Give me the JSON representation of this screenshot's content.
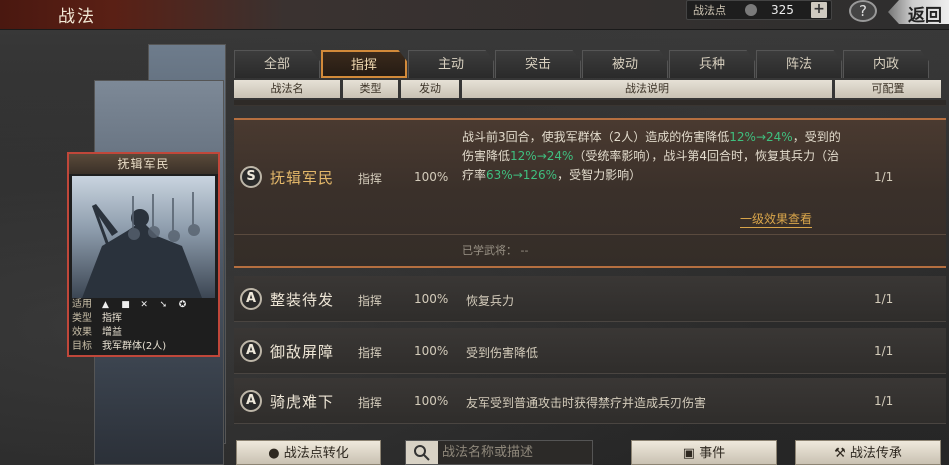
{
  "header": {
    "title": "战法",
    "points_label": "战法点",
    "points_value": "325",
    "plus_label": "+",
    "help_label": "?",
    "back_label": "返回"
  },
  "card": {
    "title": "抚辑军民",
    "info": [
      {
        "key": "适用",
        "value": ""
      },
      {
        "key": "类型",
        "value": "指挥"
      },
      {
        "key": "效果",
        "value": "增益"
      },
      {
        "key": "目标",
        "value": "我军群体(2人)"
      }
    ]
  },
  "tabs": [
    "全部",
    "指挥",
    "主动",
    "突击",
    "被动",
    "兵种",
    "阵法",
    "内政"
  ],
  "active_tab": 1,
  "columns": [
    "战法名",
    "类型",
    "发动",
    "战法说明",
    "可配置"
  ],
  "expanded": {
    "grade": "S",
    "name": "抚辑军民",
    "type": "指挥",
    "rate": "100%",
    "count": "1/1",
    "desc_parts": [
      {
        "t": "战斗前3回合，使我军群体（2人）造成的伤害降低",
        "hl": false
      },
      {
        "t": "12%→24%",
        "hl": true
      },
      {
        "t": "，受到的伤害降低",
        "hl": false
      },
      {
        "t": "12%→24%",
        "hl": true
      },
      {
        "t": "（受统率影响），战斗第4回合时，恢复其兵力（治疗率",
        "hl": false
      },
      {
        "t": "63%→126%",
        "hl": true
      },
      {
        "t": "，受智力影响）",
        "hl": false
      }
    ],
    "link": "一级效果查看",
    "learned": "已学武将：  --"
  },
  "rows": [
    {
      "grade": "A",
      "name": "整装待发",
      "type": "指挥",
      "rate": "100%",
      "desc": "恢复兵力",
      "count": "1/1"
    },
    {
      "grade": "A",
      "name": "御敌屏障",
      "type": "指挥",
      "rate": "100%",
      "desc": "受到伤害降低",
      "count": "1/1"
    },
    {
      "grade": "A",
      "name": "骑虎难下",
      "type": "指挥",
      "rate": "100%",
      "desc": "友军受到普通攻击时获得禁疗并造成兵刃伤害",
      "count": "1/1"
    }
  ],
  "bottom": {
    "convert_label": "战法点转化",
    "search_placeholder": "战法名称或描述",
    "events_label": "事件",
    "inherit_label": "战法传承"
  }
}
